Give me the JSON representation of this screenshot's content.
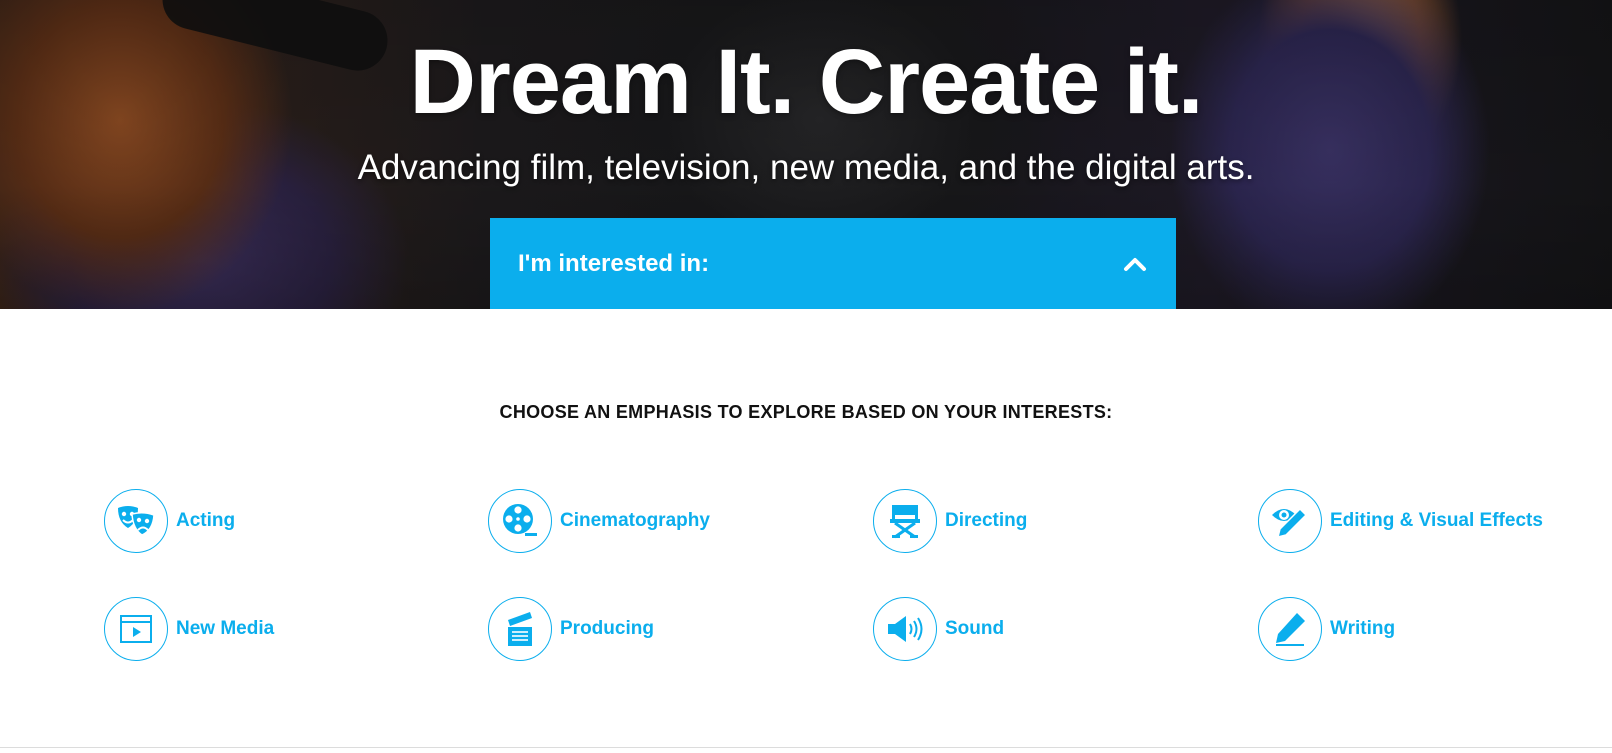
{
  "hero": {
    "title": "Dream It. Create it.",
    "subtitle": "Advancing film, television, new media, and the digital arts."
  },
  "interest_selector": {
    "label": "I'm interested in:",
    "icon": "chevron-up-icon",
    "expanded": true
  },
  "emphasis": {
    "heading": "CHOOSE AN EMPHASIS TO EXPLORE BASED ON YOUR INTERESTS:",
    "items": [
      {
        "label": "Acting",
        "icon": "theater-masks-icon"
      },
      {
        "label": "Cinematography",
        "icon": "film-reel-icon"
      },
      {
        "label": "Directing",
        "icon": "directors-chair-icon"
      },
      {
        "label": "Editing & Visual Effects",
        "icon": "eye-pencil-icon"
      },
      {
        "label": "New Media",
        "icon": "video-window-icon"
      },
      {
        "label": "Producing",
        "icon": "clapperboard-icon"
      },
      {
        "label": "Sound",
        "icon": "speaker-icon"
      },
      {
        "label": "Writing",
        "icon": "pen-icon"
      }
    ]
  },
  "colors": {
    "accent": "#0baeed",
    "heading_text": "#111111",
    "hero_text": "#ffffff"
  }
}
